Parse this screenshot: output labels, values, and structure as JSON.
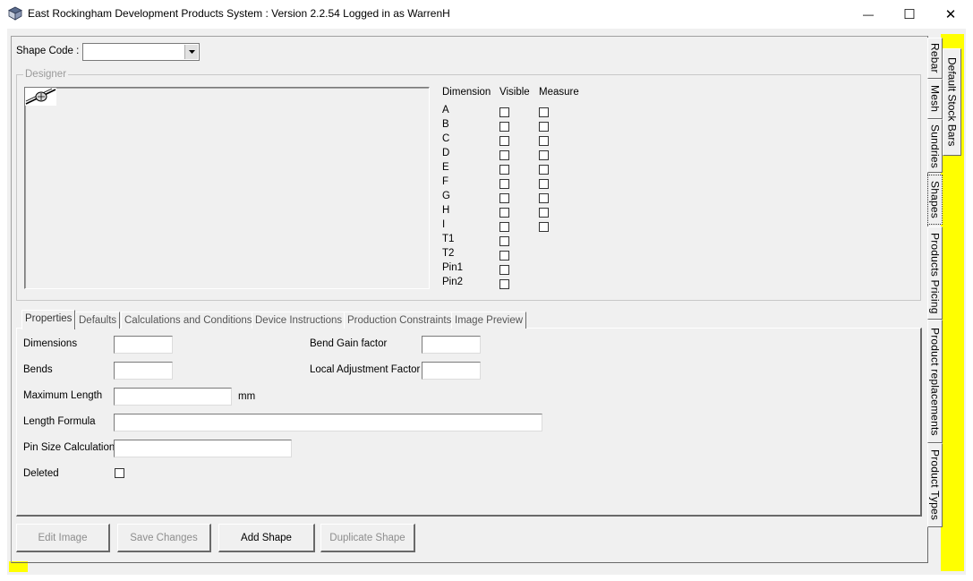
{
  "window": {
    "title": "East Rockingham Development Products System : Version 2.2.54 Logged in as WarrenH",
    "minimize_glyph": "—",
    "maximize_glyph": "☐",
    "close_glyph": "✕"
  },
  "shape_code": {
    "label": "Shape Code :",
    "value": ""
  },
  "designer": {
    "title": "Designer",
    "headers": {
      "dimension": "Dimension",
      "visible": "Visible",
      "measure": "Measure"
    },
    "rows": [
      {
        "name": "A",
        "has_measure": true
      },
      {
        "name": "B",
        "has_measure": true
      },
      {
        "name": "C",
        "has_measure": true
      },
      {
        "name": "D",
        "has_measure": true
      },
      {
        "name": "E",
        "has_measure": true
      },
      {
        "name": "F",
        "has_measure": true
      },
      {
        "name": "G",
        "has_measure": true
      },
      {
        "name": "H",
        "has_measure": true
      },
      {
        "name": "I",
        "has_measure": true
      },
      {
        "name": "T1",
        "has_measure": false
      },
      {
        "name": "T2",
        "has_measure": false
      },
      {
        "name": "Pin1",
        "has_measure": false
      },
      {
        "name": "Pin2",
        "has_measure": false
      }
    ]
  },
  "tabs": [
    "Properties",
    "Defaults",
    "Calculations and Conditions",
    "Device Instructions",
    "Production Constraints",
    "Image Preview"
  ],
  "properties": {
    "dimensions_label": "Dimensions",
    "bends_label": "Bends",
    "max_length_label": "Maximum Length",
    "max_length_unit": "mm",
    "length_formula_label": "Length Formula",
    "pin_size_label": "Pin Size Calculation",
    "deleted_label": "Deleted",
    "bend_gain_label": "Bend Gain factor",
    "local_adjustment_label": "Local Adjustment Factor"
  },
  "buttons": {
    "edit_image": "Edit Image",
    "save_changes": "Save Changes",
    "add_shape": "Add Shape",
    "duplicate_shape": "Duplicate Shape"
  },
  "side_tabs": [
    "Rebar",
    "Mesh",
    "Sundries",
    "Shapes",
    "Products Pricing",
    "Product replacements",
    "Product Types"
  ],
  "default_stock_bars_tab": "Default Stock Bars",
  "colors": {
    "accent_yellow": "#ffff00",
    "window_bg": "#f0f0f0"
  }
}
